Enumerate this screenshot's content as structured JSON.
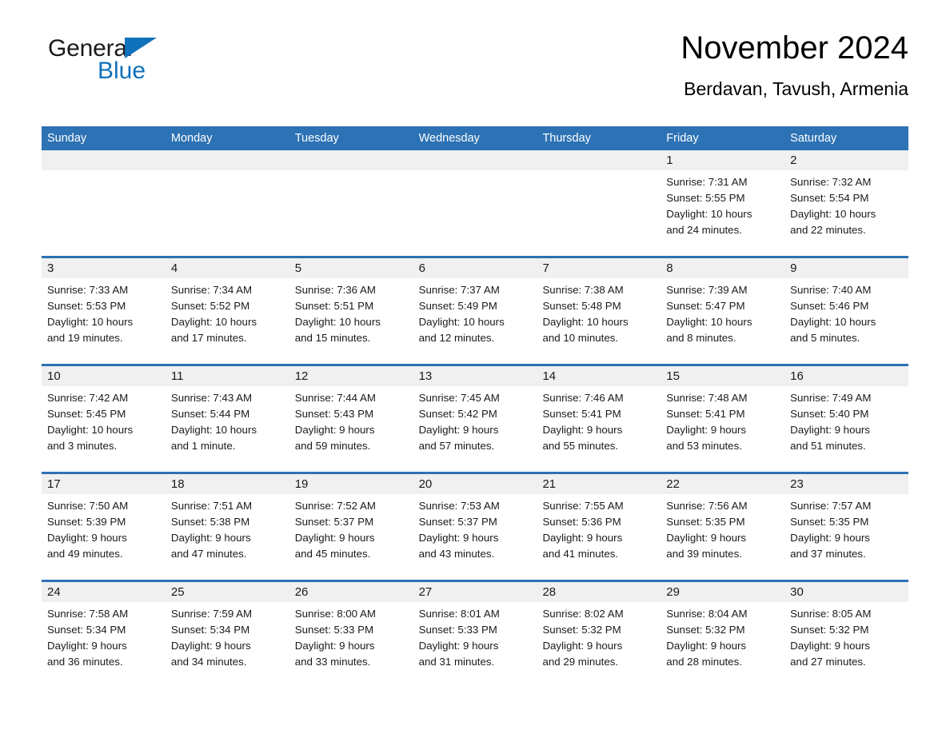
{
  "brand": {
    "name_part1": "General",
    "name_part2": "Blue",
    "flag_icon": "triangle-flag-icon"
  },
  "header": {
    "title": "November 2024",
    "subtitle": "Berdavan, Tavush, Armenia"
  },
  "colors": {
    "header_blue": "#2d72b4",
    "brand_blue": "#1072bb",
    "daynum_band": "#f0f0f0",
    "text": "#1a1a1a"
  },
  "weekdays": [
    "Sunday",
    "Monday",
    "Tuesday",
    "Wednesday",
    "Thursday",
    "Friday",
    "Saturday"
  ],
  "weeks": [
    [
      {
        "day": "",
        "sunrise": "",
        "sunset": "",
        "daylight": "",
        "daylight2": "",
        "empty": true
      },
      {
        "day": "",
        "sunrise": "",
        "sunset": "",
        "daylight": "",
        "daylight2": "",
        "empty": true
      },
      {
        "day": "",
        "sunrise": "",
        "sunset": "",
        "daylight": "",
        "daylight2": "",
        "empty": true
      },
      {
        "day": "",
        "sunrise": "",
        "sunset": "",
        "daylight": "",
        "daylight2": "",
        "empty": true
      },
      {
        "day": "",
        "sunrise": "",
        "sunset": "",
        "daylight": "",
        "daylight2": "",
        "empty": true
      },
      {
        "day": "1",
        "sunrise": "Sunrise: 7:31 AM",
        "sunset": "Sunset: 5:55 PM",
        "daylight": "Daylight: 10 hours",
        "daylight2": "and 24 minutes.",
        "empty": false
      },
      {
        "day": "2",
        "sunrise": "Sunrise: 7:32 AM",
        "sunset": "Sunset: 5:54 PM",
        "daylight": "Daylight: 10 hours",
        "daylight2": "and 22 minutes.",
        "empty": false
      }
    ],
    [
      {
        "day": "3",
        "sunrise": "Sunrise: 7:33 AM",
        "sunset": "Sunset: 5:53 PM",
        "daylight": "Daylight: 10 hours",
        "daylight2": "and 19 minutes.",
        "empty": false
      },
      {
        "day": "4",
        "sunrise": "Sunrise: 7:34 AM",
        "sunset": "Sunset: 5:52 PM",
        "daylight": "Daylight: 10 hours",
        "daylight2": "and 17 minutes.",
        "empty": false
      },
      {
        "day": "5",
        "sunrise": "Sunrise: 7:36 AM",
        "sunset": "Sunset: 5:51 PM",
        "daylight": "Daylight: 10 hours",
        "daylight2": "and 15 minutes.",
        "empty": false
      },
      {
        "day": "6",
        "sunrise": "Sunrise: 7:37 AM",
        "sunset": "Sunset: 5:49 PM",
        "daylight": "Daylight: 10 hours",
        "daylight2": "and 12 minutes.",
        "empty": false
      },
      {
        "day": "7",
        "sunrise": "Sunrise: 7:38 AM",
        "sunset": "Sunset: 5:48 PM",
        "daylight": "Daylight: 10 hours",
        "daylight2": "and 10 minutes.",
        "empty": false
      },
      {
        "day": "8",
        "sunrise": "Sunrise: 7:39 AM",
        "sunset": "Sunset: 5:47 PM",
        "daylight": "Daylight: 10 hours",
        "daylight2": "and 8 minutes.",
        "empty": false
      },
      {
        "day": "9",
        "sunrise": "Sunrise: 7:40 AM",
        "sunset": "Sunset: 5:46 PM",
        "daylight": "Daylight: 10 hours",
        "daylight2": "and 5 minutes.",
        "empty": false
      }
    ],
    [
      {
        "day": "10",
        "sunrise": "Sunrise: 7:42 AM",
        "sunset": "Sunset: 5:45 PM",
        "daylight": "Daylight: 10 hours",
        "daylight2": "and 3 minutes.",
        "empty": false
      },
      {
        "day": "11",
        "sunrise": "Sunrise: 7:43 AM",
        "sunset": "Sunset: 5:44 PM",
        "daylight": "Daylight: 10 hours",
        "daylight2": "and 1 minute.",
        "empty": false
      },
      {
        "day": "12",
        "sunrise": "Sunrise: 7:44 AM",
        "sunset": "Sunset: 5:43 PM",
        "daylight": "Daylight: 9 hours",
        "daylight2": "and 59 minutes.",
        "empty": false
      },
      {
        "day": "13",
        "sunrise": "Sunrise: 7:45 AM",
        "sunset": "Sunset: 5:42 PM",
        "daylight": "Daylight: 9 hours",
        "daylight2": "and 57 minutes.",
        "empty": false
      },
      {
        "day": "14",
        "sunrise": "Sunrise: 7:46 AM",
        "sunset": "Sunset: 5:41 PM",
        "daylight": "Daylight: 9 hours",
        "daylight2": "and 55 minutes.",
        "empty": false
      },
      {
        "day": "15",
        "sunrise": "Sunrise: 7:48 AM",
        "sunset": "Sunset: 5:41 PM",
        "daylight": "Daylight: 9 hours",
        "daylight2": "and 53 minutes.",
        "empty": false
      },
      {
        "day": "16",
        "sunrise": "Sunrise: 7:49 AM",
        "sunset": "Sunset: 5:40 PM",
        "daylight": "Daylight: 9 hours",
        "daylight2": "and 51 minutes.",
        "empty": false
      }
    ],
    [
      {
        "day": "17",
        "sunrise": "Sunrise: 7:50 AM",
        "sunset": "Sunset: 5:39 PM",
        "daylight": "Daylight: 9 hours",
        "daylight2": "and 49 minutes.",
        "empty": false
      },
      {
        "day": "18",
        "sunrise": "Sunrise: 7:51 AM",
        "sunset": "Sunset: 5:38 PM",
        "daylight": "Daylight: 9 hours",
        "daylight2": "and 47 minutes.",
        "empty": false
      },
      {
        "day": "19",
        "sunrise": "Sunrise: 7:52 AM",
        "sunset": "Sunset: 5:37 PM",
        "daylight": "Daylight: 9 hours",
        "daylight2": "and 45 minutes.",
        "empty": false
      },
      {
        "day": "20",
        "sunrise": "Sunrise: 7:53 AM",
        "sunset": "Sunset: 5:37 PM",
        "daylight": "Daylight: 9 hours",
        "daylight2": "and 43 minutes.",
        "empty": false
      },
      {
        "day": "21",
        "sunrise": "Sunrise: 7:55 AM",
        "sunset": "Sunset: 5:36 PM",
        "daylight": "Daylight: 9 hours",
        "daylight2": "and 41 minutes.",
        "empty": false
      },
      {
        "day": "22",
        "sunrise": "Sunrise: 7:56 AM",
        "sunset": "Sunset: 5:35 PM",
        "daylight": "Daylight: 9 hours",
        "daylight2": "and 39 minutes.",
        "empty": false
      },
      {
        "day": "23",
        "sunrise": "Sunrise: 7:57 AM",
        "sunset": "Sunset: 5:35 PM",
        "daylight": "Daylight: 9 hours",
        "daylight2": "and 37 minutes.",
        "empty": false
      }
    ],
    [
      {
        "day": "24",
        "sunrise": "Sunrise: 7:58 AM",
        "sunset": "Sunset: 5:34 PM",
        "daylight": "Daylight: 9 hours",
        "daylight2": "and 36 minutes.",
        "empty": false
      },
      {
        "day": "25",
        "sunrise": "Sunrise: 7:59 AM",
        "sunset": "Sunset: 5:34 PM",
        "daylight": "Daylight: 9 hours",
        "daylight2": "and 34 minutes.",
        "empty": false
      },
      {
        "day": "26",
        "sunrise": "Sunrise: 8:00 AM",
        "sunset": "Sunset: 5:33 PM",
        "daylight": "Daylight: 9 hours",
        "daylight2": "and 33 minutes.",
        "empty": false
      },
      {
        "day": "27",
        "sunrise": "Sunrise: 8:01 AM",
        "sunset": "Sunset: 5:33 PM",
        "daylight": "Daylight: 9 hours",
        "daylight2": "and 31 minutes.",
        "empty": false
      },
      {
        "day": "28",
        "sunrise": "Sunrise: 8:02 AM",
        "sunset": "Sunset: 5:32 PM",
        "daylight": "Daylight: 9 hours",
        "daylight2": "and 29 minutes.",
        "empty": false
      },
      {
        "day": "29",
        "sunrise": "Sunrise: 8:04 AM",
        "sunset": "Sunset: 5:32 PM",
        "daylight": "Daylight: 9 hours",
        "daylight2": "and 28 minutes.",
        "empty": false
      },
      {
        "day": "30",
        "sunrise": "Sunrise: 8:05 AM",
        "sunset": "Sunset: 5:32 PM",
        "daylight": "Daylight: 9 hours",
        "daylight2": "and 27 minutes.",
        "empty": false
      }
    ]
  ]
}
